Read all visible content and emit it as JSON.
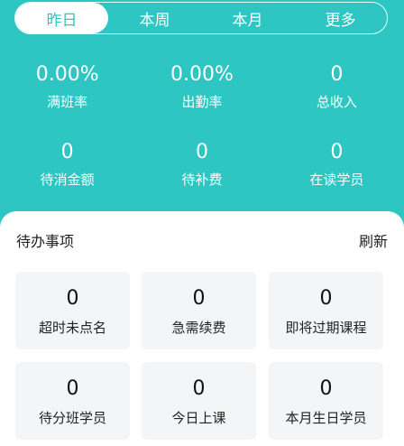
{
  "tabs": [
    {
      "label": "昨日",
      "active": true
    },
    {
      "label": "本周",
      "active": false
    },
    {
      "label": "本月",
      "active": false
    },
    {
      "label": "更多",
      "active": false
    }
  ],
  "stats": [
    {
      "value": "0.00%",
      "label": "满班率"
    },
    {
      "value": "0.00%",
      "label": "出勤率"
    },
    {
      "value": "0",
      "label": "总收入"
    },
    {
      "value": "0",
      "label": "待消金额"
    },
    {
      "value": "0",
      "label": "待补费"
    },
    {
      "value": "0",
      "label": "在读学员"
    }
  ],
  "todo": {
    "title": "待办事项",
    "refresh_label": "刷新",
    "items": [
      {
        "value": "0",
        "label": "超时未点名"
      },
      {
        "value": "0",
        "label": "急需续费"
      },
      {
        "value": "0",
        "label": "即将过期课程"
      },
      {
        "value": "0",
        "label": "待分班学员"
      },
      {
        "value": "0",
        "label": "今日上课"
      },
      {
        "value": "0",
        "label": "本月生日学员"
      }
    ]
  },
  "colors": {
    "accent": "#2ec6c3",
    "card_bg": "#f4f5f7"
  }
}
